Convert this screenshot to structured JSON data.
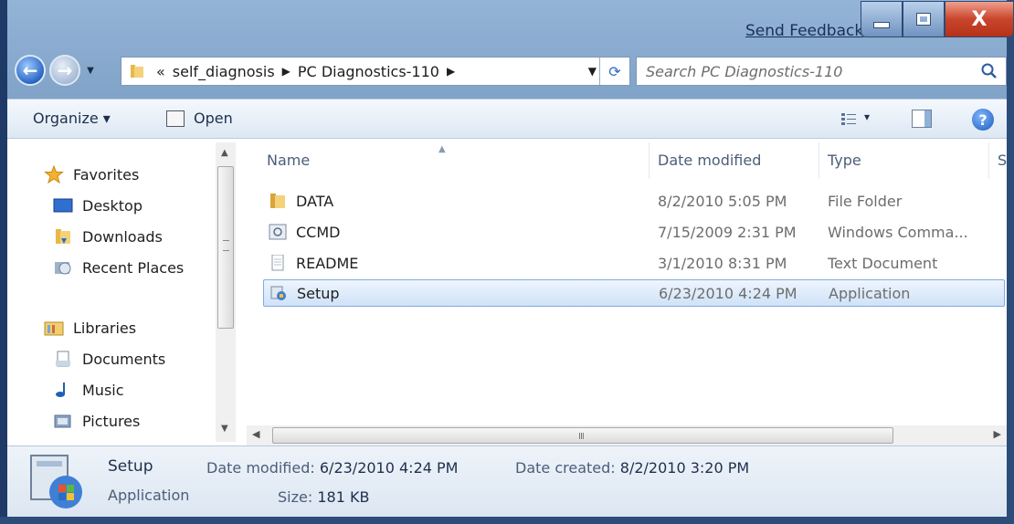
{
  "titlebar": {
    "send_feedback": "Send Feedback",
    "minimize_label": "",
    "maximize_label": "",
    "close_label": "X"
  },
  "nav": {
    "address": {
      "overflow": "«",
      "crumbs": [
        "self_diagnosis",
        "PC Diagnostics-110"
      ],
      "separator": "▶"
    },
    "search_placeholder": "Search PC Diagnostics-110"
  },
  "toolbar": {
    "organize_label": "Organize ▾",
    "open_label": "Open",
    "views_label": "▾",
    "help_label": "?"
  },
  "sidebar": {
    "favorites_header": "Favorites",
    "favorites": [
      "Desktop",
      "Downloads",
      "Recent Places"
    ],
    "libraries_header": "Libraries",
    "libraries": [
      "Documents",
      "Music",
      "Pictures"
    ]
  },
  "files": {
    "columns": [
      "Name",
      "Date modified",
      "Type",
      "S"
    ],
    "rows": [
      {
        "name": "DATA",
        "date": "8/2/2010 5:05 PM",
        "type": "File Folder",
        "icon": "folder-icon"
      },
      {
        "name": "CCMD",
        "date": "7/15/2009 2:31 PM",
        "type": "Windows Comma...",
        "icon": "command-file-icon"
      },
      {
        "name": "README",
        "date": "3/1/2010 8:31 PM",
        "type": "Text Document",
        "icon": "text-document-icon"
      },
      {
        "name": "Setup",
        "date": "6/23/2010 4:24 PM",
        "type": "Application",
        "icon": "setup-application-icon",
        "selected": true
      }
    ],
    "hscroll_grip": "III"
  },
  "details": {
    "name": "Setup",
    "type": "Application",
    "date_modified_label": "Date modified:",
    "date_modified": "6/23/2010 4:24 PM",
    "size_label": "Size:",
    "size": "181 KB",
    "date_created_label": "Date created:",
    "date_created": "8/2/2010 3:20 PM"
  }
}
